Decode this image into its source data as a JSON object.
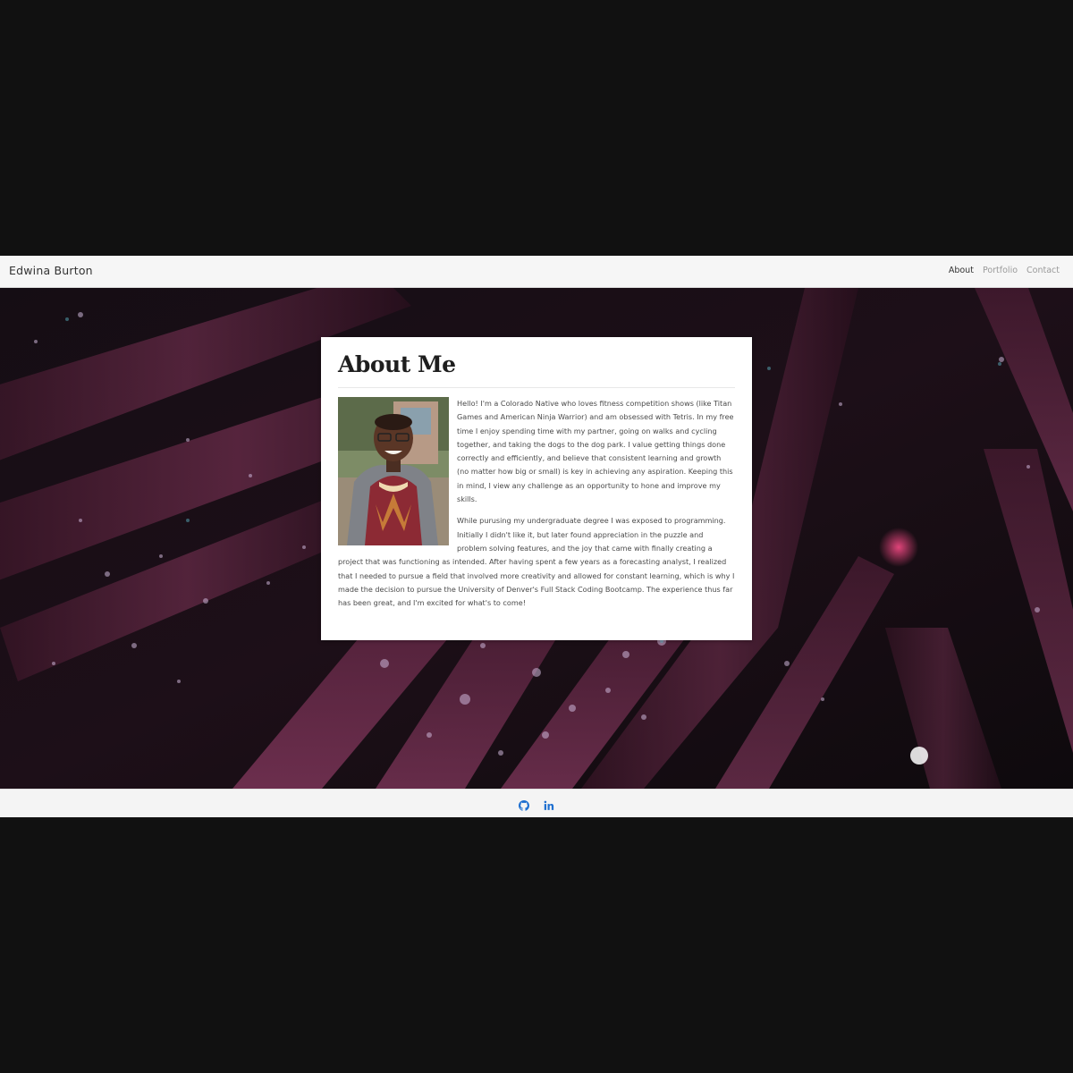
{
  "header": {
    "brand": "Edwina Burton",
    "nav": [
      {
        "label": "About",
        "active": true
      },
      {
        "label": "Portfolio",
        "active": false
      },
      {
        "label": "Contact",
        "active": false
      }
    ]
  },
  "about": {
    "title": "About Me",
    "paragraphs": [
      "Hello! I'm a Colorado Native who loves fitness competition shows (like Titan Games and American Ninja Warrior) and am obsessed with Tetris. In my free time I enjoy spending time with my partner, going on walks and cycling together, and taking the dogs to the dog park. I value getting things done correctly and efficiently, and believe that consistent learning and growth (no matter how big or small) is key in achieving any aspiration. Keeping this in mind, I view any challenge as an opportunity to hone and improve my skills.",
      "While purusing my undergraduate degree I was exposed to programming. Initially I didn't like it, but later found appreciation in the puzzle and problem solving features, and the joy that came with finally creating a project that was functioning as intended. After having spent a few years as a forecasting analyst, I realized that I needed to pursue a field that involved more creativity and allowed for constant learning, which is why I made the decision to pursue the University of Denver's Full Stack Coding Bootcamp. The experience thus far has been great, and I'm excited for what's to come!"
    ]
  },
  "footer": {
    "social_icons": [
      "github-icon",
      "linkedin-icon"
    ]
  },
  "colors": {
    "link_blue": "#1e6fd0",
    "hero_dark": "#1a0f16",
    "leaf_purple": "#5a2540"
  }
}
